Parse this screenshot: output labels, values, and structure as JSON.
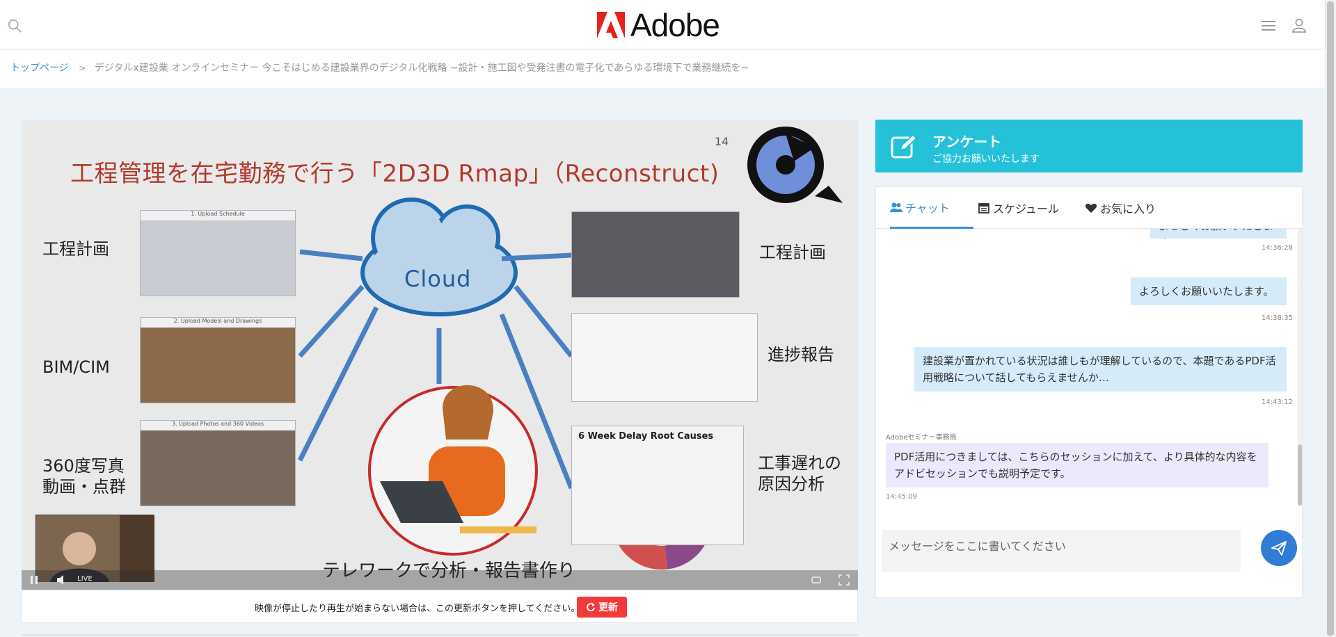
{
  "header": {
    "brand": "Adobe",
    "icons": {
      "search": "search-icon",
      "menu": "hamburger-menu-icon",
      "user": "user-icon"
    }
  },
  "breadcrumb": {
    "home": "トップページ",
    "current": "デジタルx建設業 オンラインセミナー 今こそはじめる建設業界のデジタル化戦略 ~設計・施工図や受発注書の電子化であらゆる環境下で業務継続を~"
  },
  "video": {
    "slide_number": "14",
    "title": "工程管理を在宅勤務で行う「2D3D Rmap」（Reconstruct)",
    "left_labels": [
      "工程計画",
      "BIM/CIM",
      "360度写真",
      "動画・点群"
    ],
    "right_labels": [
      "工程計画",
      "進捗報告",
      "工事遅れの",
      "原因分析"
    ],
    "thumb_captions": [
      "1. Upload Schedule",
      "2. Upload Models and Drawings",
      "3. Upload Photos and 360 Videos"
    ],
    "cloud": "Cloud",
    "delay_chart_title": "6 Week Delay Root Causes",
    "telework": "テレワークで分析・報告書作り",
    "live_label": "LIVE"
  },
  "refresh": {
    "message": "映像が停止したり再生が始まらない場合は、この更新ボタンを押してください。",
    "button": "更新"
  },
  "survey": {
    "title": "アンケート",
    "subtitle": "ご協力お願いいたします",
    "color": "#25c1d9"
  },
  "tabs": [
    {
      "label": "チャット",
      "icon": "users-icon",
      "active": true
    },
    {
      "label": "スケジュール",
      "icon": "calendar-icon",
      "active": false
    },
    {
      "label": "お気に入り",
      "icon": "heart-icon",
      "active": false
    }
  ],
  "chat": {
    "messages": [
      {
        "text": "よろしくお願いいたします。",
        "time": "14:36:28",
        "partial": true
      },
      {
        "text": "よろしくお願いいたします。",
        "time": "14:38:35"
      },
      {
        "text": "建設業が置かれている状況は誰しもが理解しているので、本題であるPDF活用戦略について話してもらえませんか…",
        "time": "14:43:12"
      },
      {
        "sender": "Adobeセミナー事務局",
        "text": "PDF活用につきましては、こちらのセッションに加えて、より具体的な内容をアドビセッションでも説明予定です。",
        "time": "14:45:09"
      }
    ],
    "input_placeholder": "メッセージをここに書いてください",
    "send_icon": "paper-plane-icon"
  },
  "colors": {
    "accent": "#3a8fd6",
    "refresh": "#f23a3a",
    "send": "#2f7dd4"
  }
}
